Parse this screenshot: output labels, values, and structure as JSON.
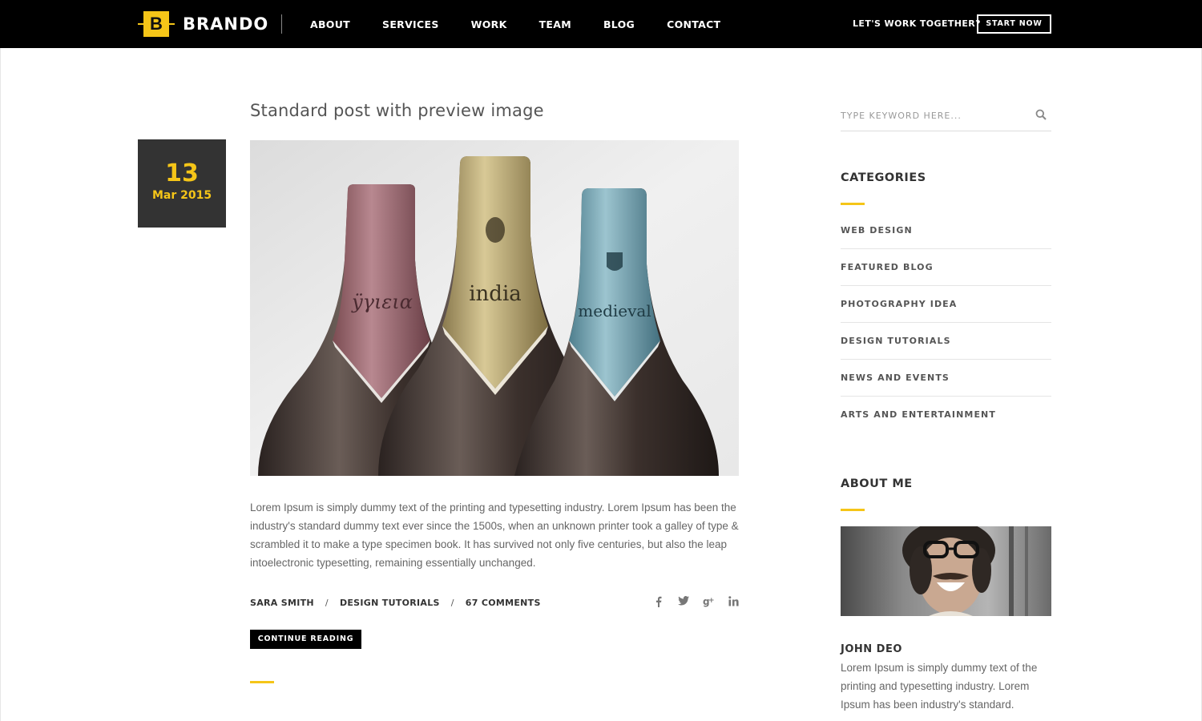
{
  "brand": {
    "mark": "B",
    "name": "BRANDO",
    "accent": "#f5c518"
  },
  "nav": [
    {
      "label": "ABOUT"
    },
    {
      "label": "SERVICES"
    },
    {
      "label": "WORK"
    },
    {
      "label": "TEAM"
    },
    {
      "label": "BLOG"
    },
    {
      "label": "CONTACT"
    }
  ],
  "header_cta": {
    "text": "LET'S WORK TOGETHER?",
    "button": "START NOW"
  },
  "post": {
    "title": "Standard post with preview image",
    "date_day": "13",
    "date_month": "Mar 2015",
    "image_labels": [
      "ÿγιεια",
      "india",
      "medieval"
    ],
    "excerpt": "Lorem Ipsum is simply dummy text of the printing and typesetting industry. Lorem Ipsum has been the industry's standard dummy text ever since the 1500s, when an unknown printer took a galley of type & scrambled it to make a type specimen book. It has survived not only five centuries, but also the leap intoelectronic typesetting, remaining essentially unchanged.",
    "author": "SARA SMITH",
    "category": "DESIGN TUTORIALS",
    "comments": "67 COMMENTS",
    "separator": "/",
    "share_icons": [
      "facebook-icon",
      "twitter-icon",
      "google-plus-icon",
      "linkedin-icon"
    ],
    "continue_label": "CONTINUE READING"
  },
  "sidebar": {
    "search_placeholder": "TYPE KEYWORD HERE...",
    "categories_title": "CATEGORIES",
    "categories": [
      {
        "label": "WEB DESIGN"
      },
      {
        "label": "FEATURED BLOG"
      },
      {
        "label": "PHOTOGRAPHY IDEA"
      },
      {
        "label": "DESIGN TUTORIALS"
      },
      {
        "label": "NEWS AND EVENTS"
      },
      {
        "label": "ARTS AND ENTERTAINMENT"
      }
    ],
    "about_title": "ABOUT ME",
    "about_name": "JOHN DEO",
    "about_text": "Lorem Ipsum is simply dummy text of the printing and typesetting industry. Lorem Ipsum has been industry's standard."
  }
}
